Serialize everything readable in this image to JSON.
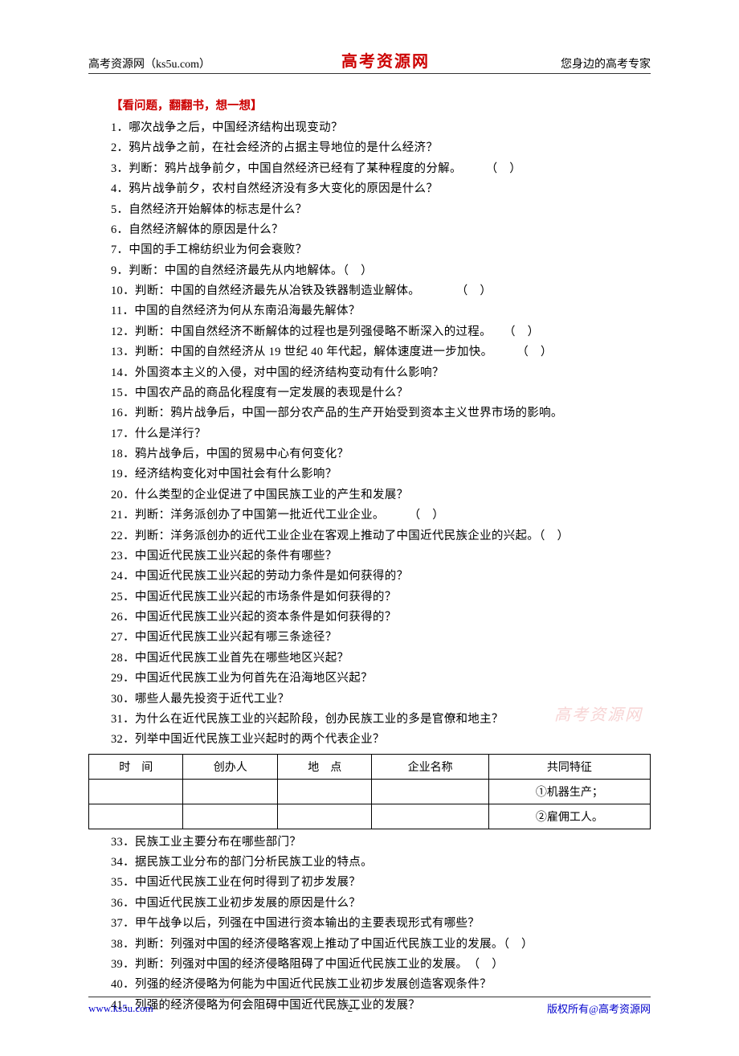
{
  "header": {
    "left": "高考资源网（ks5u.com）",
    "center": "高考资源网",
    "right": "您身边的高考专家"
  },
  "section_title": "【看问题，翻翻书，想一想】",
  "questions_block1": [
    "1．哪次战争之后，中国经济结构出现变动？",
    "2．鸦片战争之前，在社会经济的占据主导地位的是什么经济？",
    "3．判断：鸦片战争前夕，中国自然经济已经有了某种程度的分解。　　　（　）",
    "4．鸦片战争前夕，农村自然经济没有多大变化的原因是什么？",
    "5．自然经济开始解体的标志是什么？",
    "6．自然经济解体的原因是什么？",
    "7．中国的手工棉纺织业为何会衰败？",
    "9．判断：中国的自然经济最先从内地解体。（　）",
    "10．判断：中国的自然经济最先从冶铁及铁器制造业解体。　　　　（　）",
    "11．中国的自然经济为何从东南沿海最先解体？",
    "12．判断：中国自然经济不断解体的过程也是列强侵略不断深入的过程。　　（　）",
    "13．判断：中国的自然经济从 19 世纪 40 年代起，解体速度进一步加快。　　　（　）",
    "14．外国资本主义的入侵，对中国的经济结构变动有什么影响？",
    "15．中国农产品的商品化程度有一定发展的表现是什么？",
    "16．判断：鸦片战争后，中国一部分农产品的生产开始受到资本主义世界市场的影响。",
    "17．什么是洋行？",
    "18．鸦片战争后，中国的贸易中心有何变化？",
    "19．经济结构变化对中国社会有什么影响？",
    "20．什么类型的企业促进了中国民族工业的产生和发展？",
    "21．判断：洋务派创办了中国第一批近代工业企业。　　　（　）",
    "22．判断：洋务派创办的近代工业企业在客观上推动了中国近代民族企业的兴起。（　）",
    "23．中国近代民族工业兴起的条件有哪些？",
    "24．中国近代民族工业兴起的劳动力条件是如何获得的？",
    "25．中国近代民族工业兴起的市场条件是如何获得的？",
    "26．中国近代民族工业兴起的资本条件是如何获得的？",
    "27．中国近代民族工业兴起有哪三条途径？",
    "28．中国近代民族工业首先在哪些地区兴起？",
    "29．中国近代民族工业为何首先在沿海地区兴起？",
    "30．哪些人最先投资于近代工业？",
    "31．为什么在近代民族工业的兴起阶段，创办民族工业的多是官僚和地主？",
    "32．列举中国近代民族工业兴起时的两个代表企业？"
  ],
  "table": {
    "headers": [
      "时　间",
      "创办人",
      "地　点",
      "企业名称",
      "共同特征"
    ],
    "rows": [
      [
        "",
        "",
        "",
        "",
        "①机器生产；"
      ],
      [
        "",
        "",
        "",
        "",
        "②雇佣工人。"
      ]
    ]
  },
  "questions_block2": [
    "33．民族工业主要分布在哪些部门？",
    "34．据民族工业分布的部门分析民族工业的特点。",
    "35．中国近代民族工业在何时得到了初步发展？",
    "36．中国近代民族工业初步发展的原因是什么？",
    "37．甲午战争以后，列强在中国进行资本输出的主要表现形式有哪些？",
    "38．判断：列强对中国的经济侵略客观上推动了中国近代民族工业的发展。（　）",
    "39．判断：列强对中国的经济侵略阻碍了中国近代民族工业的发展。　（　）",
    "40．列强的经济侵略为何能为中国近代民族工业初步发展创造客观条件？",
    "41．列强的经济侵略为何会阻碍中国近代民族工业的发展？"
  ],
  "watermark": "高考资源网",
  "footer": {
    "left": "www.ks5u.com",
    "center": "- 2 -",
    "right": "版权所有@高考资源网"
  }
}
